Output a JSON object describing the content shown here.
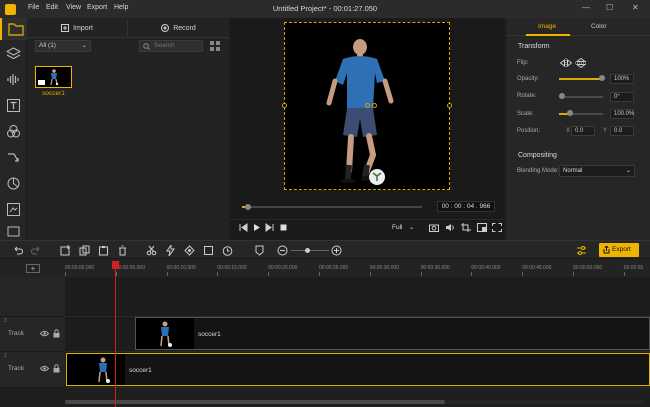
{
  "titlebar": {
    "menus": [
      "File",
      "Edit",
      "View",
      "Export",
      "Help"
    ],
    "title": "Untitled Project* - 00:01:27.050"
  },
  "media": {
    "import_label": "Import",
    "record_label": "Record",
    "filter_label": "All (1)",
    "search_placeholder": "Search",
    "item_name": "soccer1"
  },
  "preview": {
    "timecode": "00 : 00 : 04 . 966",
    "quality": "Full",
    "progress_fraction": 0.036
  },
  "props": {
    "tabs": [
      "Image",
      "Color"
    ],
    "section_transform": "Transform",
    "flip_label": "Flip:",
    "opacity_label": "Opacity:",
    "opacity_value": "100%",
    "rotate_label": "Rotate:",
    "rotate_value": "0°",
    "scale_label": "Scale:",
    "scale_value": "100.0%",
    "position_label": "Position:",
    "x_label": "X",
    "x_value": "0.0",
    "y_label": "Y",
    "y_value": "0.0",
    "section_compositing": "Compositing",
    "blend_label": "Blending Mode:",
    "blend_value": "Normal"
  },
  "toolbar": {
    "export_label": "Export"
  },
  "timeline": {
    "ticks": [
      "00:00:00.000",
      "00:00:05.000",
      "00:00:10.000",
      "00:00:15.000",
      "00:00:20.000",
      "00:00:25.000",
      "00:00:30.000",
      "00:00:35.000",
      "00:00:40.000",
      "00:00:45.000",
      "00:00:50.000",
      "00:00:55"
    ],
    "tracks": [
      {
        "number": "3",
        "name": "Track",
        "clip": "soccer1"
      },
      {
        "number": "2",
        "name": "Track",
        "clip": "soccer1"
      }
    ]
  },
  "colors": {
    "accent": "#f0b400"
  }
}
